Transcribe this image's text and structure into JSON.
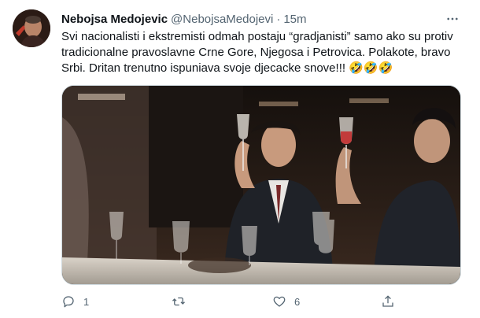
{
  "tweet": {
    "author_name": "Nebojsa Medojevic",
    "handle": "@NebojsaMedojevi",
    "separator": "·",
    "time": "15m",
    "text": "Svi nacionalisti i ekstremisti odmah postaju “gradjanisti” samo ako su protiv tradicionalne pravoslavne Crne Gore, Njegosa i Petrovica. Polakote, bravo Srbi. Dritan trenutno ispuniava svoje djecacke snove!!! 🤣🤣🤣"
  },
  "actions": {
    "reply_count": "1",
    "retweet_count": "",
    "like_count": "6"
  },
  "icons": {
    "more": "more-dots-icon",
    "reply": "reply-icon",
    "retweet": "retweet-icon",
    "like": "heart-icon",
    "share": "share-icon"
  },
  "colors": {
    "text": "#0f1419",
    "secondary": "#536471",
    "border": "#cfd9de"
  }
}
